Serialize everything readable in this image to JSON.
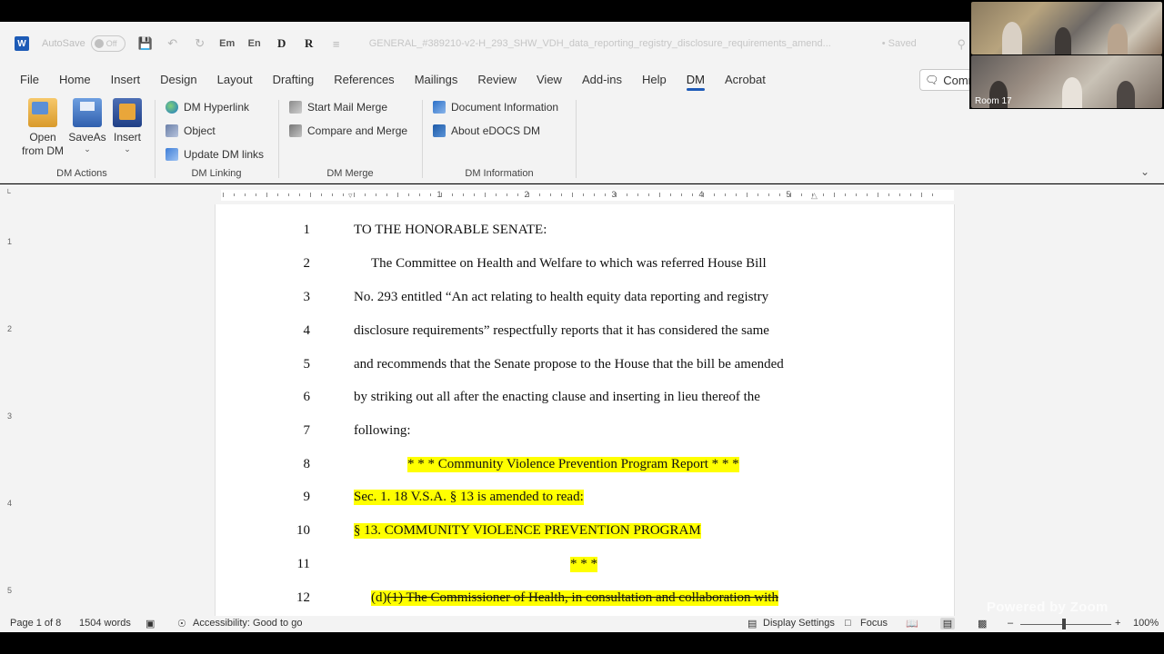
{
  "app": {
    "autosave_label": "AutoSave",
    "autosave_state": "Off",
    "document_title": "GENERAL_#389210-v2-H_293_SHW_VDH_data_reporting_registry_disclosure_requirements_amend...",
    "save_status": "• Saved",
    "quick_access": [
      "Em",
      "En",
      "D",
      "R"
    ]
  },
  "menu": {
    "tabs": [
      "File",
      "Home",
      "Insert",
      "Design",
      "Layout",
      "Drafting",
      "References",
      "Mailings",
      "Review",
      "View",
      "Add-ins",
      "Help",
      "DM",
      "Acrobat"
    ],
    "active_tab": "DM",
    "comments_label": "Comm"
  },
  "ribbon": {
    "dm_actions": {
      "label": "DM Actions",
      "open_line1": "Open",
      "open_line2": "from DM",
      "saveas": "SaveAs",
      "insert": "Insert"
    },
    "dm_linking": {
      "label": "DM Linking",
      "hyperlink": "DM Hyperlink",
      "object": "Object",
      "update_links": "Update DM links"
    },
    "dm_merge": {
      "label": "DM Merge",
      "start_mail_merge": "Start Mail Merge",
      "compare_merge": "Compare and Merge"
    },
    "dm_information": {
      "label": "DM Information",
      "doc_info": "Document Information",
      "about": "About eDOCS DM"
    }
  },
  "ruler": {
    "numbers": [
      "1",
      "2",
      "3",
      "4",
      "5"
    ],
    "vertical_numbers": [
      "1",
      "2",
      "3",
      "4",
      "5"
    ]
  },
  "document": {
    "lines": [
      {
        "n": "1",
        "text": "TO THE HONORABLE SENATE:"
      },
      {
        "n": "2",
        "text": "The Committee on Health and Welfare to which was referred House Bill"
      },
      {
        "n": "3",
        "text": "No. 293 entitled “An act relating to health equity data reporting and registry"
      },
      {
        "n": "4",
        "text": "disclosure requirements” respectfully reports that it has considered the same"
      },
      {
        "n": "5",
        "text": "and recommends that the Senate propose to the House that the bill be amended"
      },
      {
        "n": "6",
        "text": "by striking out all after the enacting clause and inserting in lieu thereof the"
      },
      {
        "n": "7",
        "text": "following:"
      },
      {
        "n": "8",
        "text": "* * * Community Violence Prevention Program Report * * *"
      },
      {
        "n": "9",
        "text": "Sec. 1.  18 V.S.A. § 13 is amended to read:"
      },
      {
        "n": "10",
        "text": "§ 13.  COMMUNITY VIOLENCE PREVENTION PROGRAM"
      },
      {
        "n": "11",
        "text": "* * *"
      },
      {
        "n": "12",
        "prefix": "(d)",
        "text": "(1)  The Commissioner of Health, in consultation and collaboration with"
      }
    ]
  },
  "status": {
    "page": "Page 1 of 8",
    "words": "1504 words",
    "accessibility": "Accessibility: Good to go",
    "display_settings": "Display Settings",
    "focus": "Focus",
    "zoom": "100%"
  },
  "zoom": {
    "room_label": "Room 17",
    "powered": "Powered by Zoom"
  }
}
